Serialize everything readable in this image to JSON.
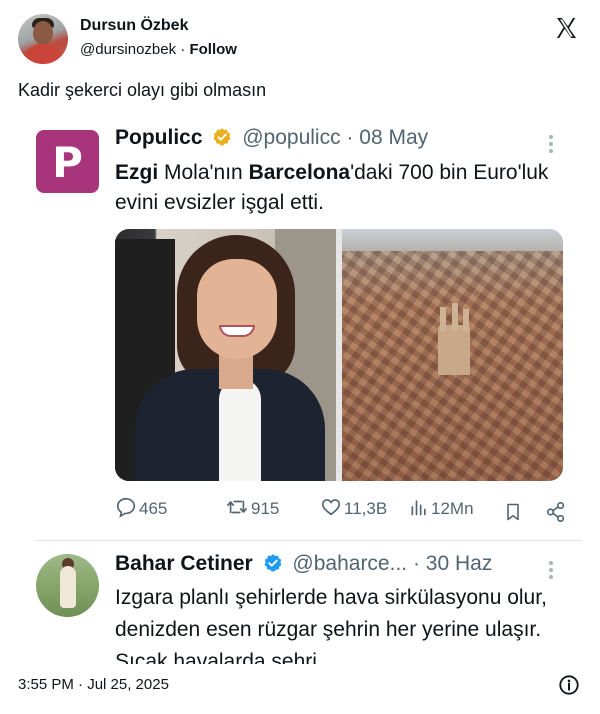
{
  "tweet": {
    "author_name": "Dursun Özbek",
    "author_handle": "@dursinozbek",
    "separator": "·",
    "follow_label": "Follow",
    "text": "Kadir şekerci olayı gibi olmasın",
    "timestamp": "3:55 PM · Jul 25, 2025",
    "platform_icon": "x-logo-icon"
  },
  "quote": {
    "author_name": "Populicc",
    "author_handle": "@populicc",
    "date": "· 08 May",
    "logo_letter": "P",
    "text_bold_1": "Ezgi",
    "text_1": " Mola'nın ",
    "text_bold_2": "Barcelona",
    "text_2": "'daki 700 bin Euro'luk evini evsizler işgal etti.",
    "actions": {
      "replies": "465",
      "retweets": "915",
      "likes": "11,3B",
      "views": "12Mn"
    },
    "brand_color": "#a8347c",
    "verified_color": "#e8b021"
  },
  "reply": {
    "author_name": "Bahar Cetiner",
    "author_handle": "@baharce...",
    "date": "· 30 Haz",
    "text": "Izgara planlı şehirlerde hava sirkülasyonu olur, denizden esen rüzgar şehrin her yerine ulaşır. Sıcak havalarda şehri",
    "verified_color": "#1d9bf0"
  }
}
